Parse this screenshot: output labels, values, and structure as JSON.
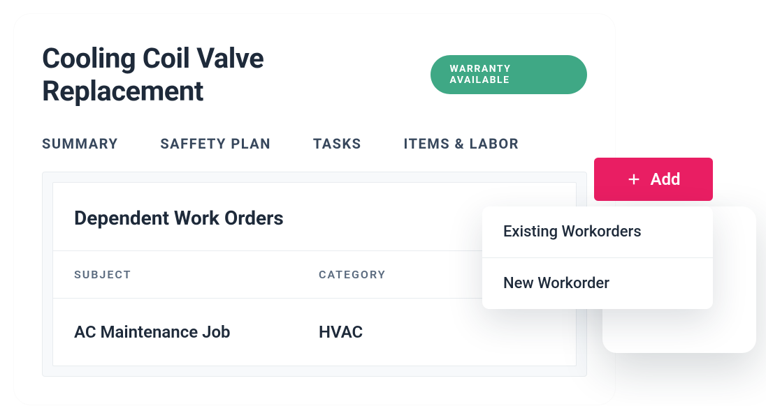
{
  "header": {
    "title": "Cooling Coil Valve Replacement",
    "badge": "WARRANTY AVAILABLE"
  },
  "tabs": [
    {
      "label": "SUMMARY"
    },
    {
      "label": "SAFFETY PLAN"
    },
    {
      "label": "TASKS"
    },
    {
      "label": "ITEMS & LABOR"
    }
  ],
  "panel": {
    "title": "Dependent Work Orders",
    "columns": {
      "subject": "SUBJECT",
      "category": "CATEGORY"
    },
    "rows": [
      {
        "subject": "AC Maintenance Job",
        "category": "HVAC"
      }
    ]
  },
  "add_button": {
    "label": "Add"
  },
  "dropdown": {
    "items": [
      {
        "label": "Existing Workorders"
      },
      {
        "label": "New Workorder"
      }
    ]
  }
}
